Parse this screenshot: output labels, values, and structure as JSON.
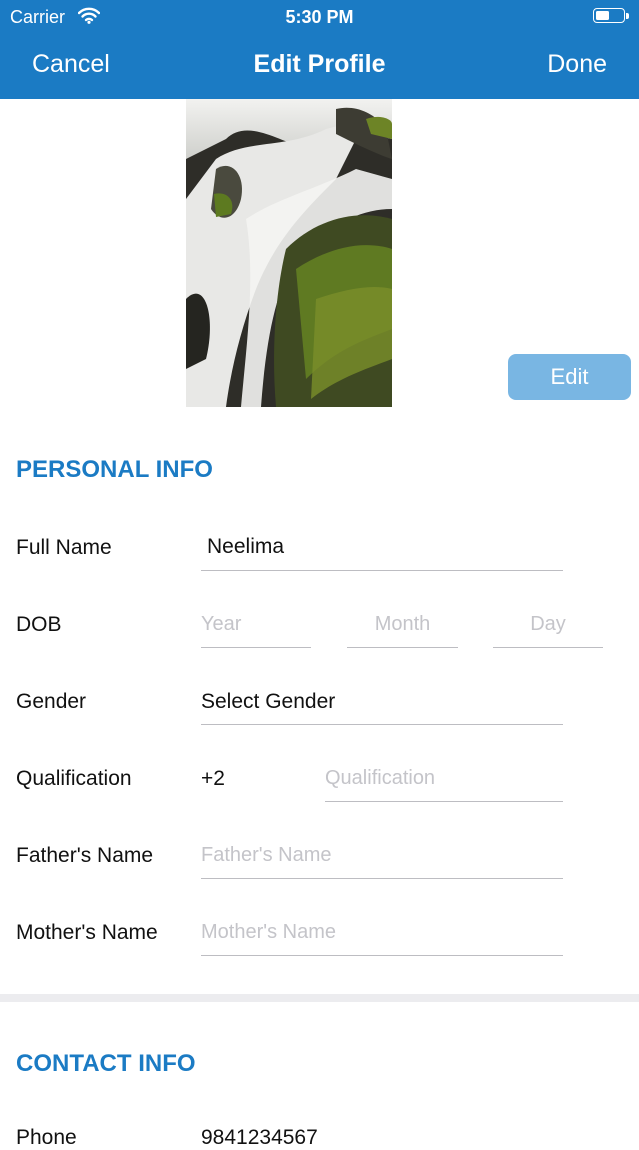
{
  "status_bar": {
    "carrier": "Carrier",
    "time": "5:30 PM"
  },
  "nav": {
    "cancel": "Cancel",
    "title": "Edit Profile",
    "done": "Done"
  },
  "photo": {
    "edit_label": "Edit"
  },
  "personal": {
    "title": "PERSONAL INFO",
    "full_name": {
      "label": "Full Name",
      "value": "Neelima"
    },
    "dob": {
      "label": "DOB",
      "year_placeholder": "Year",
      "month_placeholder": "Month",
      "day_placeholder": "Day"
    },
    "gender": {
      "label": "Gender",
      "value": "Select Gender"
    },
    "qualification": {
      "label": "Qualification",
      "level": "+2",
      "placeholder": "Qualification"
    },
    "father": {
      "label": "Father's Name",
      "placeholder": "Father's Name"
    },
    "mother": {
      "label": "Mother's Name",
      "placeholder": "Mother's Name"
    }
  },
  "contact": {
    "title": "CONTACT INFO",
    "phone": {
      "label": "Phone",
      "value": "9841234567"
    }
  },
  "colors": {
    "accent": "#1b7bc4",
    "edit_button": "#79b6e3"
  }
}
